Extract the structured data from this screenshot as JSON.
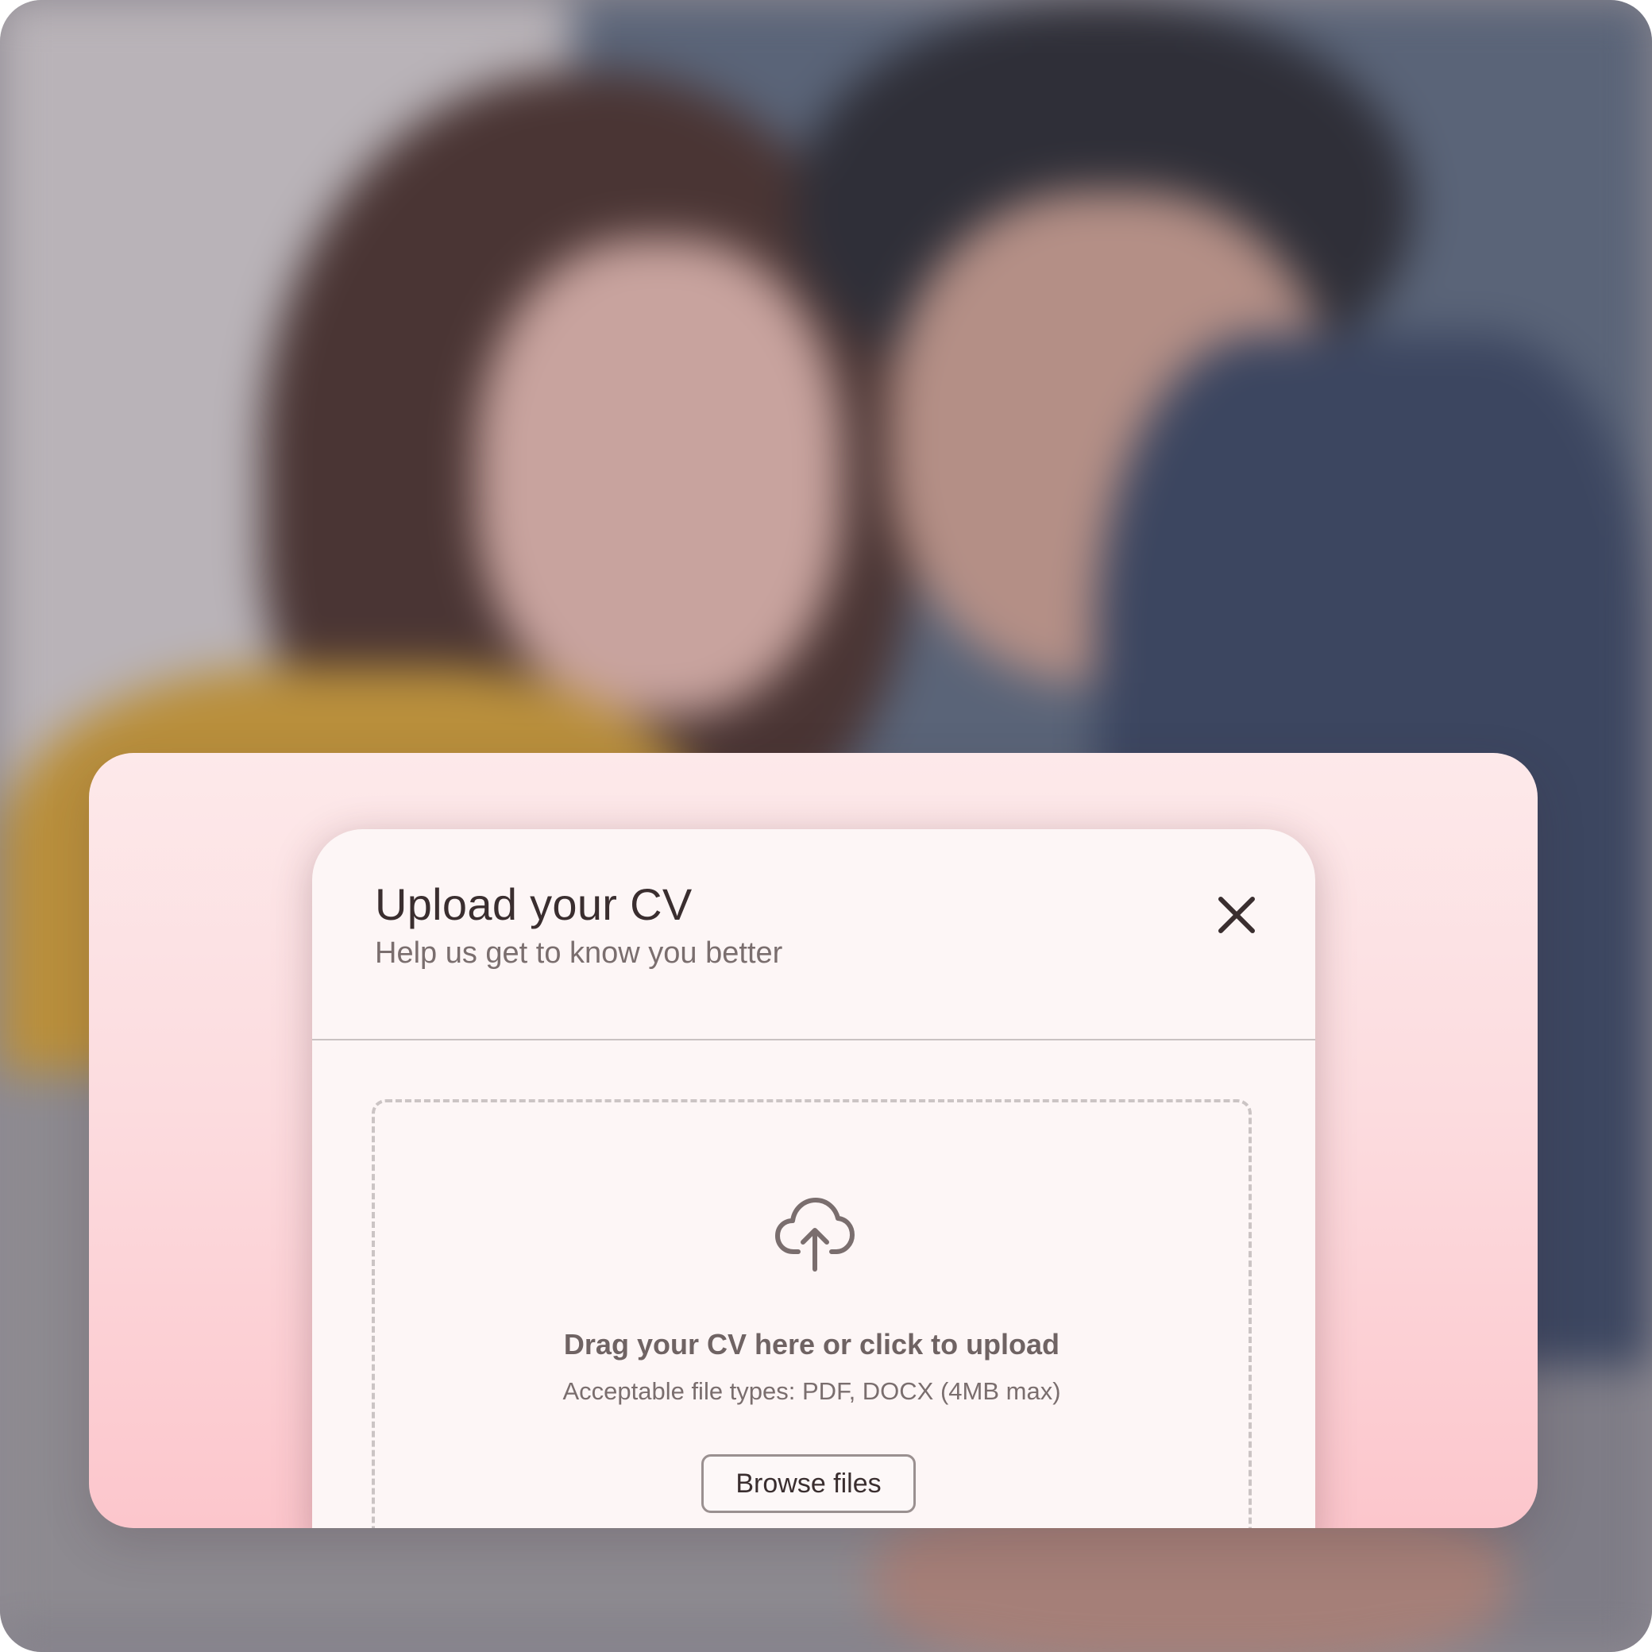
{
  "background": {
    "description_icon": "photo-background"
  },
  "dialog": {
    "title": "Upload your CV",
    "subtitle": "Help us get to know you better",
    "close_icon": "close-icon"
  },
  "dropzone": {
    "icon": "cloud-upload-icon",
    "title": "Drag your CV here or click to upload",
    "hint": "Acceptable file types: PDF, DOCX (4MB max)",
    "browse_label": "Browse files"
  },
  "colors": {
    "card_gradient_top": "#fde9ea",
    "card_gradient_bottom": "#fcc6cc",
    "dialog_bg": "#fdf6f6",
    "title_text": "#3a2e2f",
    "muted_text": "#7a6e6e",
    "dashed_border": "#cbc4c4"
  }
}
